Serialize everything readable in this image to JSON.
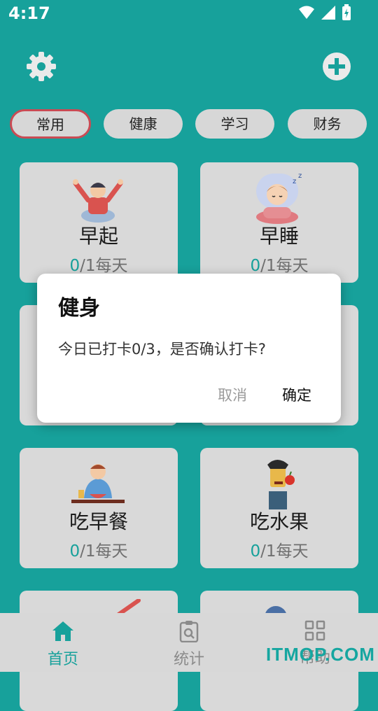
{
  "status_bar": {
    "time": "4:17",
    "icons": [
      "wifi-icon",
      "signal-icon",
      "battery-icon"
    ]
  },
  "header": {
    "settings_icon": "gear-icon",
    "add_icon": "plus-circle-icon"
  },
  "tabs": [
    {
      "label": "常用",
      "active": true
    },
    {
      "label": "健康",
      "active": false
    },
    {
      "label": "学习",
      "active": false
    },
    {
      "label": "财务",
      "active": false
    }
  ],
  "cards": [
    {
      "name": "早起",
      "done": "0",
      "rest": "/1每天"
    },
    {
      "name": "早睡",
      "done": "0",
      "rest": "/1每天"
    },
    {
      "name": "吃早餐",
      "done": "0",
      "rest": "/1每天"
    },
    {
      "name": "吃水果",
      "done": "0",
      "rest": "/1每天"
    }
  ],
  "dialog": {
    "title": "健身",
    "message": "今日已打卡0/3，是否确认打卡?",
    "cancel_label": "取消",
    "ok_label": "确定"
  },
  "bottom_nav": [
    {
      "label": "首页",
      "icon": "home-icon",
      "active": true
    },
    {
      "label": "统计",
      "icon": "clipboard-icon",
      "active": false
    },
    {
      "label": "帮助",
      "icon": "grid-icon",
      "active": false
    }
  ],
  "colors": {
    "accent": "#17a19b",
    "tab_active_border": "#c94b54",
    "overlay": "rgba(0,0,0,0.35)"
  },
  "watermark": "ITMOP.COM"
}
